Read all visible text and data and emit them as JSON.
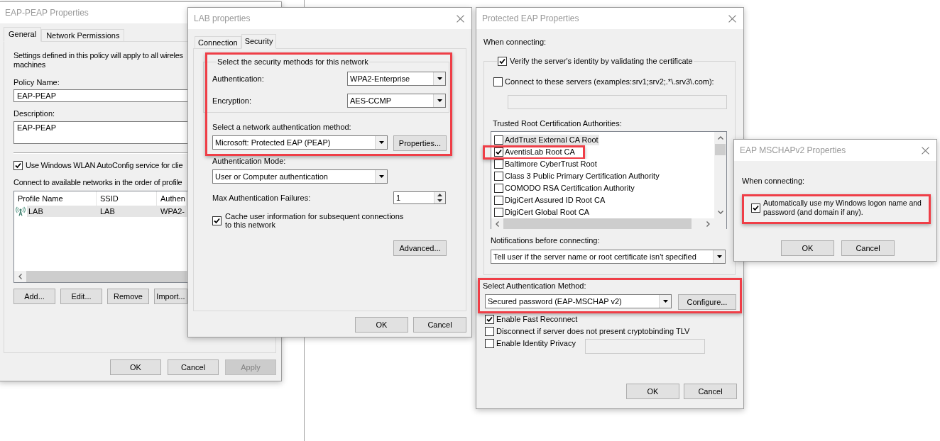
{
  "policy_window": {
    "title": "EAP-PEAP Properties",
    "tabs": [
      {
        "label": "General",
        "selected": true
      },
      {
        "label": "Network Permissions",
        "selected": false
      }
    ],
    "intro": [
      "Settings defined in this policy will apply to all wireles",
      "machines"
    ],
    "fields": [
      {
        "kind": "input",
        "label": "Policy Name:",
        "value": "EAP-PEAP"
      },
      {
        "kind": "textarea",
        "label": "Description:",
        "value": "EAP-PEAP"
      }
    ],
    "autoconfig": {
      "label": "Use Windows WLAN AutoConfig service for clie",
      "checked": true
    },
    "profiles_label": "Connect to available networks in the order of profile",
    "profiles_table": {
      "columns": [
        "Profile Name",
        "SSID",
        "Authen"
      ],
      "rows": [
        {
          "cells": [
            "LAB",
            "LAB",
            "WPA2-"
          ],
          "selected": true
        }
      ]
    },
    "profile_buttons": [
      "Add...",
      "Edit...",
      "Remove",
      "Import..."
    ],
    "buttons": [
      {
        "label": "OK",
        "disabled": false
      },
      {
        "label": "Cancel",
        "disabled": false
      },
      {
        "label": "Apply",
        "disabled": true
      }
    ]
  },
  "lab_window": {
    "title": "LAB properties",
    "tabs": [
      {
        "label": "Connection",
        "selected": false
      },
      {
        "label": "Security",
        "selected": true
      }
    ],
    "security": {
      "highlighted": true,
      "legend": "Select the security methods for this network",
      "selects": [
        {
          "label": "Authentication:",
          "value": "WPA2-Enterprise"
        },
        {
          "label": "Encryption:",
          "value": "AES-CCMP"
        }
      ],
      "method_label": "Select a network authentication method:",
      "method": "Microsoft: Protected EAP (PEAP)",
      "method_button": "Properties..."
    },
    "auth_mode": {
      "label": "Authentication Mode:",
      "value": "User or Computer authentication"
    },
    "max_failures": {
      "label": "Max Authentication Failures:",
      "value": "1"
    },
    "cache": {
      "label": "Cache user information for subsequent connections to this network",
      "checked": true
    },
    "advanced_button": "Advanced...",
    "buttons": [
      "OK",
      "Cancel"
    ]
  },
  "peap_window": {
    "title": "Protected EAP Properties",
    "heading": "When connecting:",
    "verify": {
      "label": "Verify the server's identity by validating the certificate",
      "checked": true
    },
    "connect_servers": {
      "label": "Connect to these servers (examples:srv1;srv2;.*\\.srv3\\.com):",
      "checked": false
    },
    "authorities_label": "Trusted Root Certification Authorities:",
    "authorities": [
      {
        "name": "AddTrust External CA Root",
        "checked": false,
        "selected": true,
        "highlighted": false
      },
      {
        "name": "AventisLab Root CA",
        "checked": true,
        "selected": false,
        "highlighted": true
      },
      {
        "name": "Baltimore CyberTrust Root",
        "checked": false,
        "selected": false,
        "highlighted": false
      },
      {
        "name": "Class 3 Public Primary Certification Authority",
        "checked": false,
        "selected": false,
        "highlighted": false
      },
      {
        "name": "COMODO RSA Certification Authority",
        "checked": false,
        "selected": false,
        "highlighted": false
      },
      {
        "name": "DigiCert Assured ID Root CA",
        "checked": false,
        "selected": false,
        "highlighted": false
      },
      {
        "name": "DigiCert Global Root CA",
        "checked": false,
        "selected": false,
        "highlighted": false
      }
    ],
    "notifications": {
      "label": "Notifications before connecting:",
      "value": "Tell user if the server name or root certificate isn't specified"
    },
    "auth_method": {
      "highlighted": true,
      "label": "Select Authentication Method:",
      "value": "Secured password (EAP-MSCHAP v2)",
      "button": "Configure..."
    },
    "options": [
      {
        "kind": "checkbox",
        "label": "Enable Fast Reconnect",
        "checked": true
      },
      {
        "kind": "checkbox",
        "label": "Disconnect if server does not present cryptobinding TLV",
        "checked": false
      },
      {
        "kind": "checkbox_field",
        "label": "Enable Identity Privacy",
        "checked": false
      }
    ],
    "buttons": [
      "OK",
      "Cancel"
    ]
  },
  "mschap_window": {
    "title": "EAP MSCHAPv2 Properties",
    "heading": "When connecting:",
    "auto_logon": {
      "label": "Automatically use my Windows logon name and password (and domain if any).",
      "checked": true,
      "highlighted": true
    },
    "buttons": [
      "OK",
      "Cancel"
    ]
  }
}
